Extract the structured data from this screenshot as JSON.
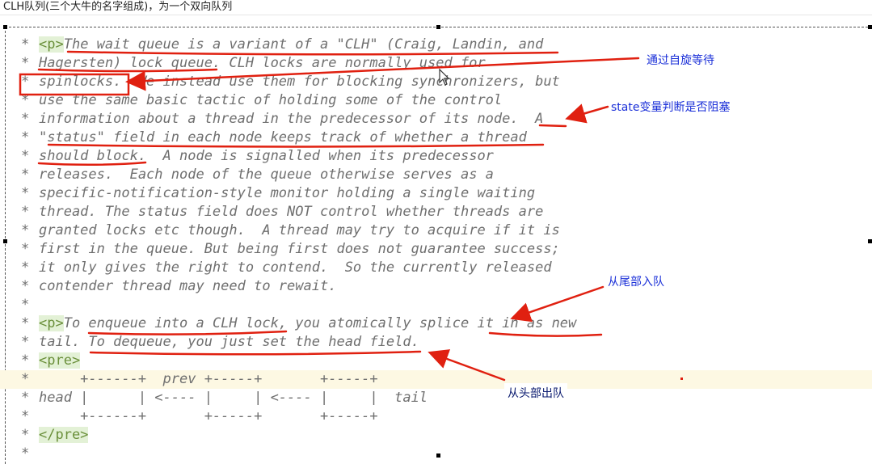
{
  "caption": "CLH队列(三个大牛的名字组成)，为一个双向队列",
  "lines": [
    {
      "star": "*",
      "parts": [
        {
          "tag": "<p>"
        },
        {
          "text": "The wait queue is a variant of a \"CLH\" (Craig, Landin, and"
        }
      ]
    },
    {
      "star": "*",
      "parts": [
        {
          "text": "Hagersten) lock queue. CLH locks are normally used for"
        }
      ]
    },
    {
      "star": "*",
      "parts": [
        {
          "text": "spinlocks.  We instead use them for blocking synchronizers, but"
        }
      ]
    },
    {
      "star": "*",
      "parts": [
        {
          "text": "use the same basic tactic of holding some of the control"
        }
      ]
    },
    {
      "star": "*",
      "parts": [
        {
          "text": "information about a thread in the predecessor of its node.  A"
        }
      ]
    },
    {
      "star": "*",
      "parts": [
        {
          "text": "\"status\" field in each node keeps track of whether a thread"
        }
      ]
    },
    {
      "star": "*",
      "parts": [
        {
          "text": "should block.  A node is signalled when its predecessor"
        }
      ]
    },
    {
      "star": "*",
      "parts": [
        {
          "text": "releases.  Each node of the queue otherwise serves as a"
        }
      ]
    },
    {
      "star": "*",
      "parts": [
        {
          "text": "specific-notification-style monitor holding a single waiting"
        }
      ]
    },
    {
      "star": "*",
      "parts": [
        {
          "text": "thread. The status field does NOT control whether threads are"
        }
      ]
    },
    {
      "star": "*",
      "parts": [
        {
          "text": "granted locks etc though.  A thread may try to acquire if it is"
        }
      ]
    },
    {
      "star": "*",
      "parts": [
        {
          "text": "first in the queue. But being first does not guarantee success;"
        }
      ]
    },
    {
      "star": "*",
      "parts": [
        {
          "text": "it only gives the right to contend.  So the currently released"
        }
      ]
    },
    {
      "star": "*",
      "parts": [
        {
          "text": "contender thread may need to rewait."
        }
      ]
    },
    {
      "star": "*",
      "parts": []
    },
    {
      "star": "*",
      "parts": [
        {
          "tag": "<p>"
        },
        {
          "text": "To enqueue into a CLH lock, you atomically splice it in as new"
        }
      ]
    },
    {
      "star": "*",
      "parts": [
        {
          "text": "tail. To dequeue, you just set the head field."
        }
      ]
    },
    {
      "star": "*",
      "parts": [
        {
          "tag": "<pre>"
        }
      ]
    },
    {
      "star": "*",
      "parts": [
        {
          "text": "     +------+  prev +-----+       +-----+"
        }
      ],
      "highlight": true
    },
    {
      "star": "*",
      "parts": [
        {
          "text": "head |      | <---- |     | <---- |     |  tail"
        }
      ]
    },
    {
      "star": "*",
      "parts": [
        {
          "text": "     +------+       +-----+       +-----+"
        }
      ]
    },
    {
      "star": "*",
      "parts": [
        {
          "tag": "</pre>"
        }
      ]
    },
    {
      "star": "*",
      "parts": []
    }
  ],
  "annotations": {
    "spin": "通过自旋等待",
    "state": "state变量判断是否阻塞",
    "enqueue": "从尾部入队",
    "dequeue": "从头部出队"
  },
  "colors": {
    "markup": "#e02010",
    "annotation": "#1a2fd8"
  }
}
